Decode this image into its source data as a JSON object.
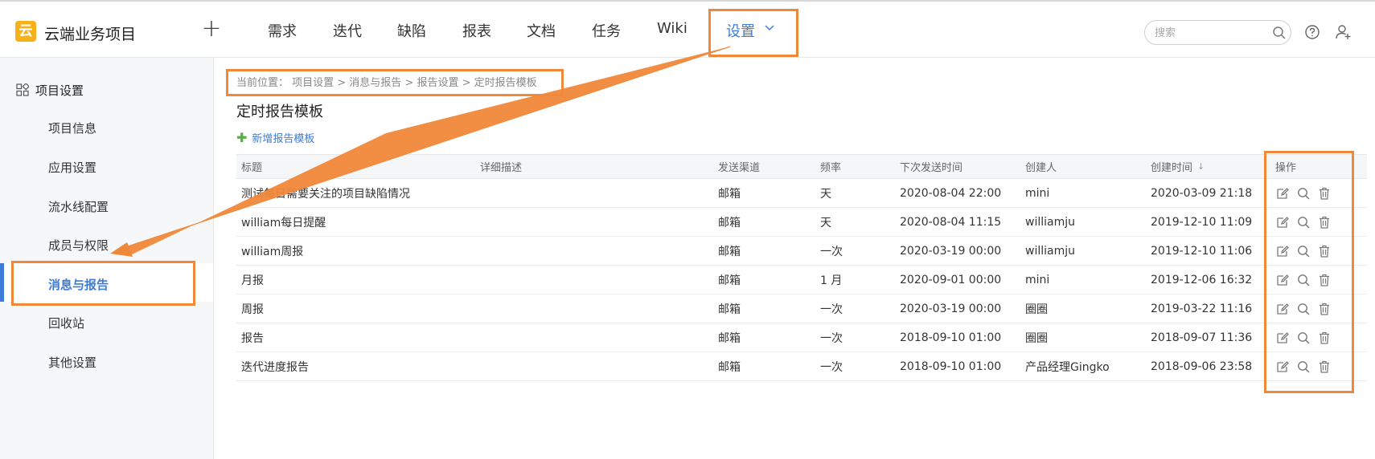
{
  "header": {
    "logo_char": "云",
    "app_title": "云端业务项目",
    "add_label": "+",
    "nav": [
      {
        "label": "需求"
      },
      {
        "label": "迭代"
      },
      {
        "label": "缺陷"
      },
      {
        "label": "报表"
      },
      {
        "label": "文档"
      },
      {
        "label": "任务"
      },
      {
        "label": "Wiki"
      },
      {
        "label": "设置",
        "active": true
      }
    ],
    "search_placeholder": "搜索"
  },
  "sidebar": {
    "heading": "项目设置",
    "items": [
      {
        "label": "项目信息"
      },
      {
        "label": "应用设置"
      },
      {
        "label": "流水线配置"
      },
      {
        "label": "成员与权限"
      },
      {
        "label": "消息与报告",
        "active": true
      },
      {
        "label": "回收站"
      },
      {
        "label": "其他设置"
      }
    ]
  },
  "main": {
    "breadcrumb": "当前位置：  项目设置  >  消息与报告  >  报告设置  >  定时报告模板",
    "title": "定时报告模板",
    "add_label": "新增报告模板",
    "table": {
      "columns": [
        "标题",
        "详细描述",
        "发送渠道",
        "频率",
        "下次发送时间",
        "创建人",
        "创建时间",
        "操作"
      ],
      "sort_indicator": "↓",
      "rows": [
        {
          "title": "测试每日需要关注的项目缺陷情况",
          "desc": "",
          "channel": "邮箱",
          "freq": "天",
          "next": "2020-08-04 22:00",
          "creator": "mini",
          "created": "2020-03-09 21:18"
        },
        {
          "title": "william每日提醒",
          "desc": "",
          "channel": "邮箱",
          "freq": "天",
          "next": "2020-08-04 11:15",
          "creator": "williamju",
          "created": "2019-12-10 11:09"
        },
        {
          "title": "william周报",
          "desc": "",
          "channel": "邮箱",
          "freq": "一次",
          "next": "2020-03-19 00:00",
          "creator": "williamju",
          "created": "2019-12-10 11:06"
        },
        {
          "title": "月报",
          "desc": "",
          "channel": "邮箱",
          "freq": "1 月",
          "next": "2020-09-01 00:00",
          "creator": "mini",
          "created": "2019-12-06 16:32"
        },
        {
          "title": "周报",
          "desc": "",
          "channel": "邮箱",
          "freq": "一次",
          "next": "2020-03-19 00:00",
          "creator": "圈圈",
          "created": "2019-03-22 11:16"
        },
        {
          "title": "报告",
          "desc": "",
          "channel": "邮箱",
          "freq": "一次",
          "next": "2018-09-10 01:00",
          "creator": "圈圈",
          "created": "2018-09-07 11:36"
        },
        {
          "title": "迭代进度报告",
          "desc": "",
          "channel": "邮箱",
          "freq": "一次",
          "next": "2018-09-10 01:00",
          "creator": "产品经理Gingko",
          "created": "2018-09-06 23:58"
        }
      ],
      "row_actions": [
        "edit-icon",
        "search-icon",
        "delete-icon"
      ]
    }
  },
  "colors": {
    "accent": "#3d7cd8",
    "annotation": "#f0883a",
    "logo": "#f7b21b",
    "add_plus": "#52b043"
  }
}
